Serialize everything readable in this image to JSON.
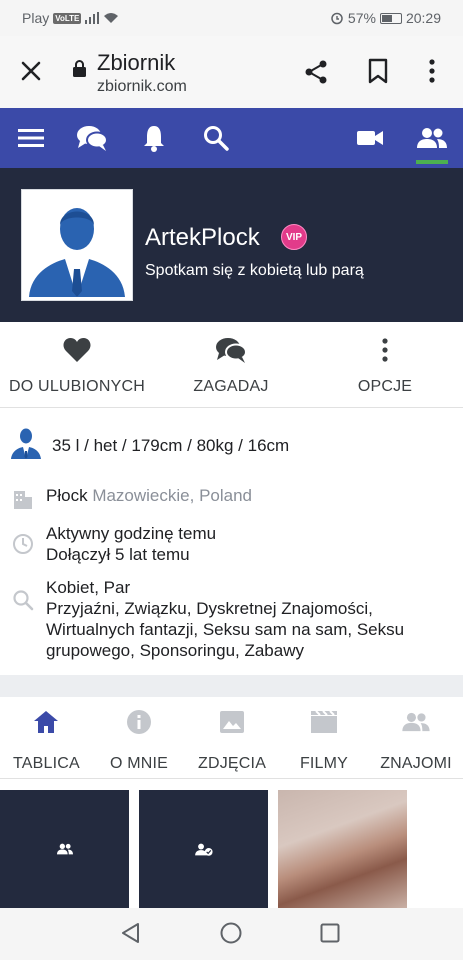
{
  "status_bar": {
    "carrier": "Play",
    "volte": "VoLTE",
    "battery": "57%",
    "battery_level": 0.57,
    "time": "20:29"
  },
  "browser": {
    "title": "Zbiornik",
    "url": "zbiornik.com"
  },
  "navbar": {
    "items": [
      "menu-icon",
      "chat-icon",
      "bell-icon",
      "search-icon",
      "video-icon",
      "friends-icon"
    ],
    "active_item": "friends-icon",
    "active_color": "#4caf50",
    "bg_color": "#3b4aa8"
  },
  "profile": {
    "username": "ArtekPlock",
    "badge": "VIP",
    "tagline": "Spotkam się z kobietą lub parą"
  },
  "actions": {
    "favorite": "DO ULUBIONYCH",
    "talk": "ZAGADAJ",
    "options": "OPCJE"
  },
  "info": {
    "stats": "35 l / het / 179cm / 80kg / 16cm",
    "city": "Płock",
    "region": "Mazowieckie, Poland",
    "activity": "Aktywny godzinę temu",
    "joined": "Dołączył 5 lat temu",
    "looking_for": "Kobiet, Par",
    "interests": "Przyjaźni, Związku, Dyskretnej Znajomości, Wirtualnych fantazji, Seksu sam na sam, Seksu grupowego, Sponsoringu, Zabawy"
  },
  "tabs": {
    "wall": "TABLICA",
    "about": "O MNIE",
    "photos": "ZDJĘCIA",
    "films": "FILMY",
    "friends": "ZNAJOMI"
  },
  "colors": {
    "header_bg": "#232a3e",
    "vip": "#e23b8a"
  }
}
